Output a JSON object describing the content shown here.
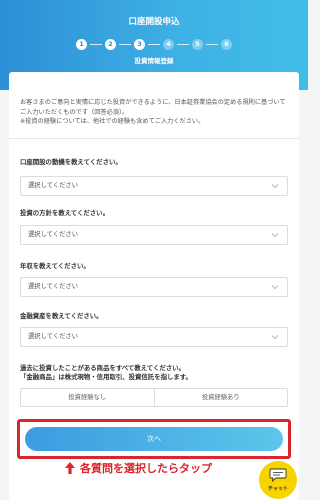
{
  "header": {
    "title": "口座開設申込",
    "steps": [
      "1",
      "2",
      "3",
      "4",
      "5",
      "6"
    ],
    "current_step": 3,
    "subtitle": "投資情報登録"
  },
  "notice": {
    "line1": "お客さまのご意向と実情に応じた投資ができるように、日本証券業協会の定める規則に基づいてご入力いただくものです（回答必須）。",
    "line2": "※投資の経験については、他社での経験も含めてご入力ください。"
  },
  "questions": [
    {
      "label": "口座開設の動機を教えてください。",
      "placeholder": "選択してください"
    },
    {
      "label": "投資の方針を教えてください。",
      "placeholder": "選択してください"
    },
    {
      "label": "年収を教えてください。",
      "placeholder": "選択してください"
    },
    {
      "label": "金融資産を教えてください。",
      "placeholder": "選択してください"
    }
  ],
  "experience": {
    "label_line1": "過去に投資したことがある商品をすべて教えてください。",
    "label_line2": "「金融商品」は株式現物・信用取引、投資信託を指します。",
    "option_none": "投資経験なし",
    "option_some": "投資経験あり"
  },
  "next_button": "次へ",
  "annotation": {
    "text": "各質問を選択したらタップ",
    "color": "#d8262f"
  },
  "chat": {
    "label": "チャット",
    "color": "#f7d300"
  },
  "colors": {
    "accent": "#2d8fd5",
    "accent_light": "#41bde7"
  }
}
